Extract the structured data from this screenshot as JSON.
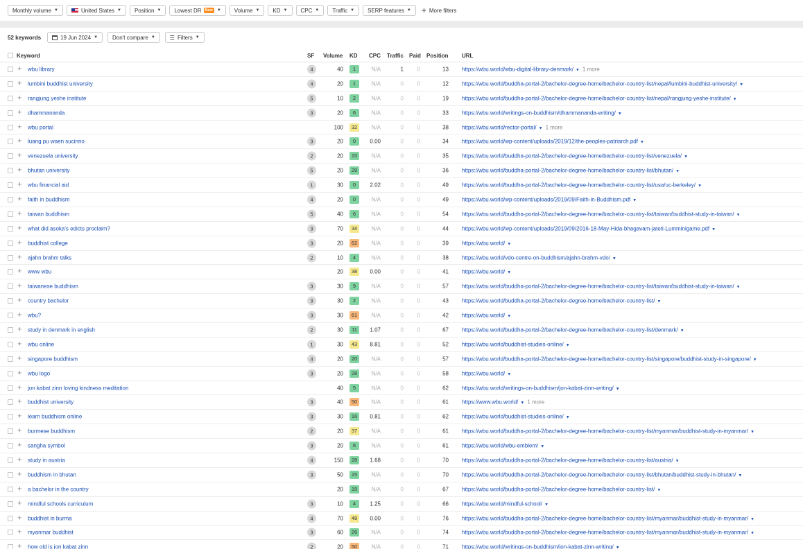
{
  "filters": [
    {
      "label": "Monthly volume"
    },
    {
      "label": "United States",
      "flag": true
    },
    {
      "label": "Position"
    },
    {
      "label": "Lowest DR",
      "badge": "New"
    },
    {
      "label": "Volume"
    },
    {
      "label": "KD"
    },
    {
      "label": "CPC"
    },
    {
      "label": "Traffic"
    },
    {
      "label": "SERP features"
    }
  ],
  "more_filters": "More filters",
  "toolbar": {
    "keyword_count": "52 keywords",
    "date": "19 Jun 2024",
    "compare": "Don't compare",
    "filters": "Filters"
  },
  "columns": {
    "keyword": "Keyword",
    "sf": "SF",
    "volume": "Volume",
    "kd": "KD",
    "cpc": "CPC",
    "traffic": "Traffic",
    "paid": "Paid",
    "position": "Position",
    "url": "URL"
  },
  "kd_colors": {
    "very_easy": "#7fd3a0",
    "easy": "#f5e88f",
    "medium": "#f9b679"
  },
  "rows": [
    {
      "keyword": "wbu library",
      "sf": "4",
      "volume": "40",
      "kd": "1",
      "cpc": "N/A",
      "traffic": "1",
      "paid": "0",
      "position": "13",
      "url": "https://wbu.world/wbu-digital-library-denmark/",
      "more": "1 more"
    },
    {
      "keyword": "lumbini buddhist university",
      "sf": "4",
      "volume": "20",
      "kd": "1",
      "cpc": "N/A",
      "traffic": "0",
      "paid": "0",
      "position": "12",
      "url": "https://wbu.world/buddha-portal-2/bachelor-degree-home/bachelor-country-list/nepal/lumbini-buddhist-university/"
    },
    {
      "keyword": "rangjung yeshe institute",
      "sf": "5",
      "volume": "10",
      "kd": "2",
      "cpc": "N/A",
      "traffic": "0",
      "paid": "0",
      "position": "19",
      "url": "https://wbu.world/buddha-portal-2/bachelor-degree-home/bachelor-country-list/nepal/rangjung-yeshe-institute/"
    },
    {
      "keyword": "dhammananda",
      "sf": "3",
      "volume": "20",
      "kd": "6",
      "cpc": "N/A",
      "traffic": "0",
      "paid": "0",
      "position": "33",
      "url": "https://wbu.world/writings-on-buddhism/dhammananda-writing/"
    },
    {
      "keyword": "wbu portal",
      "sf": "",
      "volume": "100",
      "kd": "32",
      "cpc": "N/A",
      "traffic": "0",
      "paid": "0",
      "position": "38",
      "url": "https://wbu.world/rector-portal/",
      "more": "1 more"
    },
    {
      "keyword": "luang pu waen sucinno",
      "sf": "3",
      "volume": "20",
      "kd": "0",
      "cpc": "0.00",
      "traffic": "0",
      "paid": "0",
      "position": "34",
      "url": "https://wbu.world/wp-content/uploads/2019/12/the-peoples-patriarch.pdf"
    },
    {
      "keyword": "venezuela university",
      "sf": "2",
      "volume": "20",
      "kd": "15",
      "cpc": "N/A",
      "traffic": "0",
      "paid": "0",
      "position": "35",
      "url": "https://wbu.world/buddha-portal-2/bachelor-degree-home/bachelor-country-list/venezuela/"
    },
    {
      "keyword": "bhutan university",
      "sf": "5",
      "volume": "20",
      "kd": "29",
      "cpc": "N/A",
      "traffic": "0",
      "paid": "0",
      "position": "36",
      "url": "https://wbu.world/buddha-portal-2/bachelor-degree-home/bachelor-country-list/bhutan/"
    },
    {
      "keyword": "wbu financial aid",
      "sf": "1",
      "volume": "30",
      "kd": "0",
      "cpc": "2.02",
      "traffic": "0",
      "paid": "0",
      "position": "49",
      "url": "https://wbu.world/buddha-portal-2/bachelor-degree-home/bachelor-country-list/usa/uc-berkeley/"
    },
    {
      "keyword": "faith in buddhism",
      "sf": "4",
      "volume": "20",
      "kd": "0",
      "cpc": "N/A",
      "traffic": "0",
      "paid": "0",
      "position": "49",
      "url": "https://wbu.world/wp-content/uploads/2019/09/Faith-in-Buddhism.pdf"
    },
    {
      "keyword": "taiwan buddhism",
      "sf": "5",
      "volume": "40",
      "kd": "6",
      "cpc": "N/A",
      "traffic": "0",
      "paid": "0",
      "position": "54",
      "url": "https://wbu.world/buddha-portal-2/bachelor-degree-home/bachelor-country-list/taiwan/buddhist-study-in-taiwan/"
    },
    {
      "keyword": "what did asoka's edicts proclaim?",
      "sf": "3",
      "volume": "70",
      "kd": "34",
      "cpc": "N/A",
      "traffic": "0",
      "paid": "0",
      "position": "44",
      "url": "https://wbu.world/wp-content/uploads/2019/09/2016-18-May-Hida-bhagavam-jateti-Lumminigame.pdf"
    },
    {
      "keyword": "buddhist college",
      "sf": "3",
      "volume": "20",
      "kd": "62",
      "cpc": "N/A",
      "traffic": "0",
      "paid": "0",
      "position": "39",
      "url": "https://wbu.world/"
    },
    {
      "keyword": "ajahn brahm talks",
      "sf": "2",
      "volume": "10",
      "kd": "4",
      "cpc": "N/A",
      "traffic": "0",
      "paid": "0",
      "position": "38",
      "url": "https://wbu.world/vdo-centre-on-buddhism/ajahn-brahm-vdo/"
    },
    {
      "keyword": "www wbu",
      "sf": "",
      "volume": "20",
      "kd": "38",
      "cpc": "0.00",
      "traffic": "0",
      "paid": "0",
      "position": "41",
      "url": "https://wbu.world/"
    },
    {
      "keyword": "taiwanese buddhism",
      "sf": "3",
      "volume": "30",
      "kd": "9",
      "cpc": "N/A",
      "traffic": "0",
      "paid": "0",
      "position": "57",
      "url": "https://wbu.world/buddha-portal-2/bachelor-degree-home/bachelor-country-list/taiwan/buddhist-study-in-taiwan/"
    },
    {
      "keyword": "country bachelor",
      "sf": "3",
      "volume": "30",
      "kd": "2",
      "cpc": "N/A",
      "traffic": "0",
      "paid": "0",
      "position": "43",
      "url": "https://wbu.world/buddha-portal-2/bachelor-degree-home/bachelor-country-list/"
    },
    {
      "keyword": "wbu?",
      "sf": "3",
      "volume": "30",
      "kd": "61",
      "cpc": "N/A",
      "traffic": "0",
      "paid": "0",
      "position": "42",
      "url": "https://wbu.world/"
    },
    {
      "keyword": "study in denmark in english",
      "sf": "2",
      "volume": "30",
      "kd": "11",
      "cpc": "1.07",
      "traffic": "0",
      "paid": "0",
      "position": "67",
      "url": "https://wbu.world/buddha-portal-2/bachelor-degree-home/bachelor-country-list/denmark/"
    },
    {
      "keyword": "wbu online",
      "sf": "1",
      "volume": "30",
      "kd": "43",
      "cpc": "8.81",
      "traffic": "0",
      "paid": "0",
      "position": "52",
      "url": "https://wbu.world/buddhist-studies-online/"
    },
    {
      "keyword": "singapore buddhism",
      "sf": "4",
      "volume": "20",
      "kd": "20",
      "cpc": "N/A",
      "traffic": "0",
      "paid": "0",
      "position": "57",
      "url": "https://wbu.world/buddha-portal-2/bachelor-degree-home/bachelor-country-list/singapore/buddhist-study-in-singapore/"
    },
    {
      "keyword": "wbu logo",
      "sf": "3",
      "volume": "20",
      "kd": "28",
      "cpc": "N/A",
      "traffic": "0",
      "paid": "0",
      "position": "58",
      "url": "https://wbu.world/"
    },
    {
      "keyword": "jon kabat zinn loving kindness meditation",
      "sf": "",
      "volume": "40",
      "kd": "5",
      "cpc": "N/A",
      "traffic": "0",
      "paid": "0",
      "position": "62",
      "url": "https://wbu.world/writings-on-buddhism/jon-kabat-zinn-writing/"
    },
    {
      "keyword": "buddhist university",
      "sf": "3",
      "volume": "40",
      "kd": "50",
      "cpc": "N/A",
      "traffic": "0",
      "paid": "0",
      "position": "61",
      "url": "https://www.wbu.world/",
      "more": "1 more"
    },
    {
      "keyword": "learn buddhism online",
      "sf": "3",
      "volume": "30",
      "kd": "16",
      "cpc": "0.81",
      "traffic": "0",
      "paid": "0",
      "position": "62",
      "url": "https://wbu.world/buddhist-studies-online/"
    },
    {
      "keyword": "burmese buddhism",
      "sf": "2",
      "volume": "20",
      "kd": "37",
      "cpc": "N/A",
      "traffic": "0",
      "paid": "0",
      "position": "61",
      "url": "https://wbu.world/buddha-portal-2/bachelor-degree-home/bachelor-country-list/myanmar/buddhist-study-in-myanmar/"
    },
    {
      "keyword": "sangha symbol",
      "sf": "3",
      "volume": "20",
      "kd": "8",
      "cpc": "N/A",
      "traffic": "0",
      "paid": "0",
      "position": "61",
      "url": "https://wbu.world/wbu-emblem/"
    },
    {
      "keyword": "study in austria",
      "sf": "4",
      "volume": "150",
      "kd": "28",
      "cpc": "1.68",
      "traffic": "0",
      "paid": "0",
      "position": "70",
      "url": "https://wbu.world/buddha-portal-2/bachelor-degree-home/bachelor-country-list/austria/"
    },
    {
      "keyword": "buddhism in bhutan",
      "sf": "3",
      "volume": "50",
      "kd": "15",
      "cpc": "N/A",
      "traffic": "0",
      "paid": "0",
      "position": "70",
      "url": "https://wbu.world/buddha-portal-2/bachelor-degree-home/bachelor-country-list/bhutan/buddhist-study-in-bhutan/"
    },
    {
      "keyword": "a bachelor in the country",
      "sf": "",
      "volume": "20",
      "kd": "15",
      "cpc": "N/A",
      "traffic": "0",
      "paid": "0",
      "position": "67",
      "url": "https://wbu.world/buddha-portal-2/bachelor-degree-home/bachelor-country-list/"
    },
    {
      "keyword": "mindful schools curriculum",
      "sf": "3",
      "volume": "10",
      "kd": "4",
      "cpc": "1.25",
      "traffic": "0",
      "paid": "0",
      "position": "66",
      "url": "https://wbu.world/mindful-school/"
    },
    {
      "keyword": "buddhist in burma",
      "sf": "4",
      "volume": "70",
      "kd": "48",
      "cpc": "0.00",
      "traffic": "0",
      "paid": "0",
      "position": "76",
      "url": "https://wbu.world/buddha-portal-2/bachelor-degree-home/bachelor-country-list/myanmar/buddhist-study-in-myanmar/"
    },
    {
      "keyword": "myanmar buddhist",
      "sf": "3",
      "volume": "60",
      "kd": "26",
      "cpc": "N/A",
      "traffic": "0",
      "paid": "0",
      "position": "74",
      "url": "https://wbu.world/buddha-portal-2/bachelor-degree-home/bachelor-country-list/myanmar/buddhist-study-in-myanmar/"
    },
    {
      "keyword": "how old is jon kabat zinn",
      "sf": "2",
      "volume": "20",
      "kd": "50",
      "cpc": "N/A",
      "traffic": "0",
      "paid": "0",
      "position": "71",
      "url": "https://wbu.world/writings-on-buddhism/jon-kabat-zinn-writing/"
    }
  ]
}
